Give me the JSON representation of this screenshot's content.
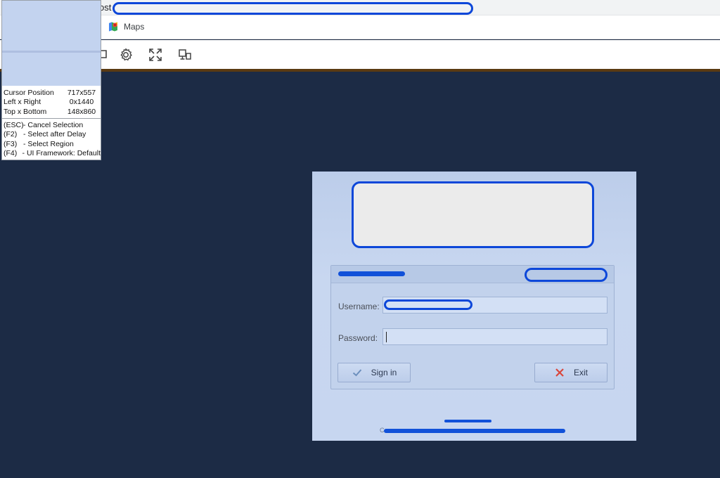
{
  "browser": {
    "address_prefix": "ost",
    "bookmark_label": "Maps",
    "toolbar_icons": [
      "screen-icon",
      "gear-icon",
      "fullscreen-icon",
      "devices-icon"
    ]
  },
  "overlay": {
    "stats": [
      {
        "label": "Cursor Position",
        "value": "717x557"
      },
      {
        "label": "Left x Right",
        "value": "0x1440"
      },
      {
        "label": "Top x Bottom",
        "value": "148x860"
      }
    ],
    "shortcuts": [
      {
        "key": "(ESC)",
        "desc": "- Cancel Selection"
      },
      {
        "key": "(F2)",
        "desc": "- Select after Delay"
      },
      {
        "key": "(F3)",
        "desc": "- Select Region"
      },
      {
        "key": "(F4)",
        "desc": "- UI Framework: Default"
      }
    ]
  },
  "login": {
    "username_label": "Username:",
    "password_label": "Password:",
    "signin_label": "Sign in",
    "exit_label": "Exit",
    "footer_prefix": "C"
  },
  "colors": {
    "background": "#1c2b45",
    "redaction": "#0d47d9",
    "panel": "#c7d6f0"
  }
}
